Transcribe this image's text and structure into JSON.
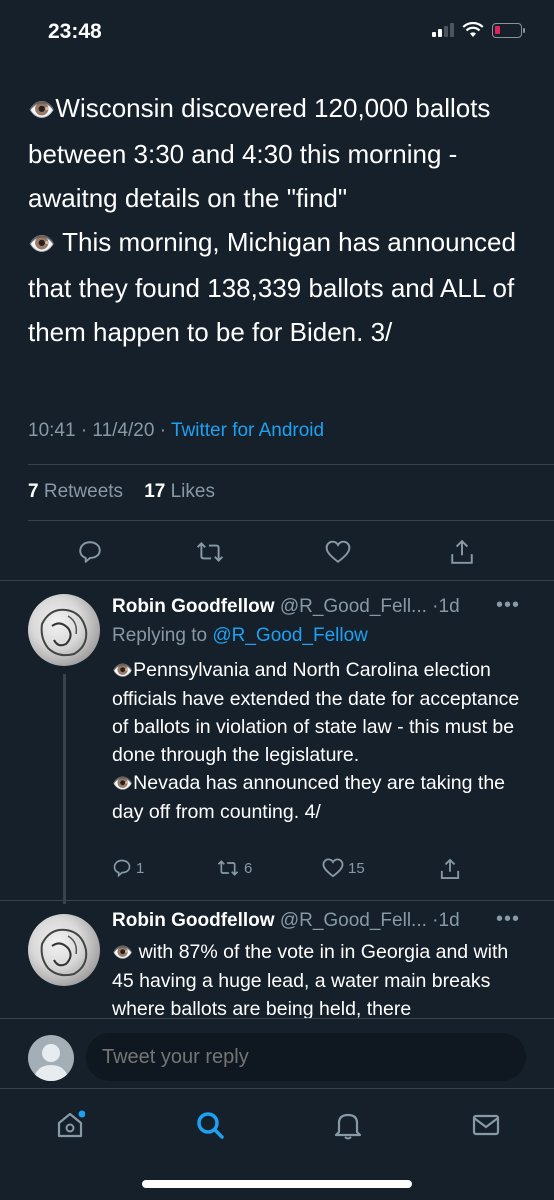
{
  "status_bar": {
    "time": "23:48"
  },
  "main_tweet": {
    "lines": [
      {
        "icon": "eye-emoji",
        "text": "Wisconsin discovered 120,000 ballots between 3:30 and 4:30 this morning - awaitng details on the \"find\""
      },
      {
        "icon": "eye-emoji",
        "text": " This morning, Michigan has announced that they found 138,339 ballots and ALL of them happen to be for Biden. 3/"
      }
    ],
    "time": "10:41 · 11/4/20 · ",
    "source": "Twitter for Android",
    "retweets_count": "7",
    "retweets_label": "Retweets",
    "likes_count": "17",
    "likes_label": "Likes"
  },
  "replies": [
    {
      "name": "Robin Goodfellow",
      "handle": "@R_Good_Fell...",
      "age": "·1d",
      "replying_prefix": "Replying to ",
      "replying_to": "@R_Good_Fellow",
      "paragraphs": [
        "Pennsylvania and North Carolina election officials have extended the date for acceptance of ballots in violation of state law - this must be done through the legislature.",
        "Nevada has announced they are taking the day off from counting. 4/"
      ],
      "reply_count": "1",
      "retweet_count": "6",
      "like_count": "15"
    },
    {
      "name": "Robin Goodfellow",
      "handle": "@R_Good_Fell...",
      "age": "·1d",
      "text": "with 87% of the vote in in Georgia and with 45 having a huge lead, a water main breaks where ballots are being held, there"
    }
  ],
  "composer": {
    "placeholder": "Tweet your reply"
  },
  "colors": {
    "background": "#15202b",
    "accent": "#1da1f2",
    "muted": "#8899a6",
    "divider": "#38444d"
  }
}
